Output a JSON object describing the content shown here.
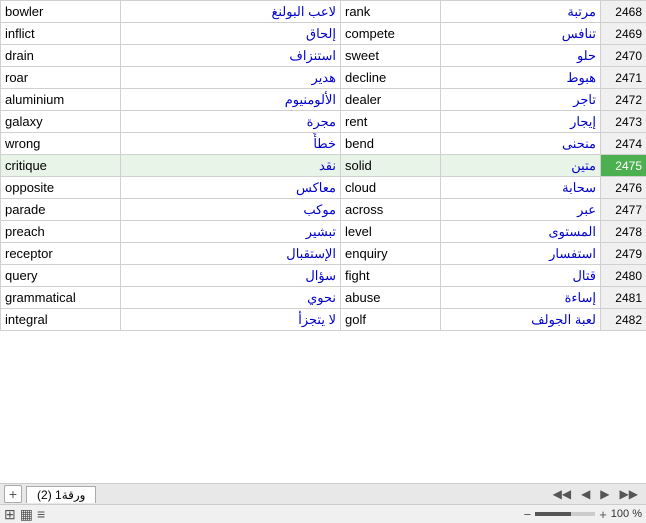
{
  "rows": [
    {
      "en": "bowler",
      "ar": "لاعب البولنغ",
      "en2": "rank",
      "ar2": "مرتبة",
      "num": "2468",
      "highlight": false
    },
    {
      "en": "inflict",
      "ar": "إلحاق",
      "en2": "compete",
      "ar2": "تنافس",
      "num": "2469",
      "highlight": false
    },
    {
      "en": "drain",
      "ar": "استنزاف",
      "en2": "sweet",
      "ar2": "حلو",
      "num": "2470",
      "highlight": false
    },
    {
      "en": "roar",
      "ar": "هدير",
      "en2": "decline",
      "ar2": "هبوط",
      "num": "2471",
      "highlight": false
    },
    {
      "en": "aluminium",
      "ar": "الألومنيوم",
      "en2": "dealer",
      "ar2": "تاجر",
      "num": "2472",
      "highlight": false
    },
    {
      "en": "galaxy",
      "ar": "مجرة",
      "en2": "rent",
      "ar2": "إيجار",
      "num": "2473",
      "highlight": false
    },
    {
      "en": "wrong",
      "ar": "خطأً",
      "en2": "bend",
      "ar2": "منحنى",
      "num": "2474",
      "highlight": false
    },
    {
      "en": "critique",
      "ar": "نقد",
      "en2": "solid",
      "ar2": "متين",
      "num": "2475",
      "highlight": true
    },
    {
      "en": "opposite",
      "ar": "معاكس",
      "en2": "cloud",
      "ar2": "سحابة",
      "num": "2476",
      "highlight": false
    },
    {
      "en": "parade",
      "ar": "موكب",
      "en2": "across",
      "ar2": "عبر",
      "num": "2477",
      "highlight": false
    },
    {
      "en": "preach",
      "ar": "تبشير",
      "en2": "level",
      "ar2": "المستوى",
      "num": "2478",
      "highlight": false
    },
    {
      "en": "receptor",
      "ar": "الإستقبال",
      "en2": "enquiry",
      "ar2": "استفسار",
      "num": "2479",
      "highlight": false
    },
    {
      "en": "query",
      "ar": "سؤال",
      "en2": "fight",
      "ar2": "قتال",
      "num": "2480",
      "highlight": false
    },
    {
      "en": "grammatical",
      "ar": "نحوي",
      "en2": "abuse",
      "ar2": "إساءة",
      "num": "2481",
      "highlight": false
    },
    {
      "en": "integral",
      "ar": "لا يتجزأ",
      "en2": "golf",
      "ar2": "لعبة الجولف",
      "num": "2482",
      "highlight": false
    }
  ],
  "tab": {
    "name": "ورقة1 (2)",
    "plus_label": "+"
  },
  "nav": {
    "prev_prev": "◀◀",
    "prev": "◀",
    "next": "▶",
    "next_next": "▶▶"
  },
  "status": {
    "zoom_percent": "100 %",
    "zoom_minus": "−",
    "zoom_plus": "+"
  }
}
